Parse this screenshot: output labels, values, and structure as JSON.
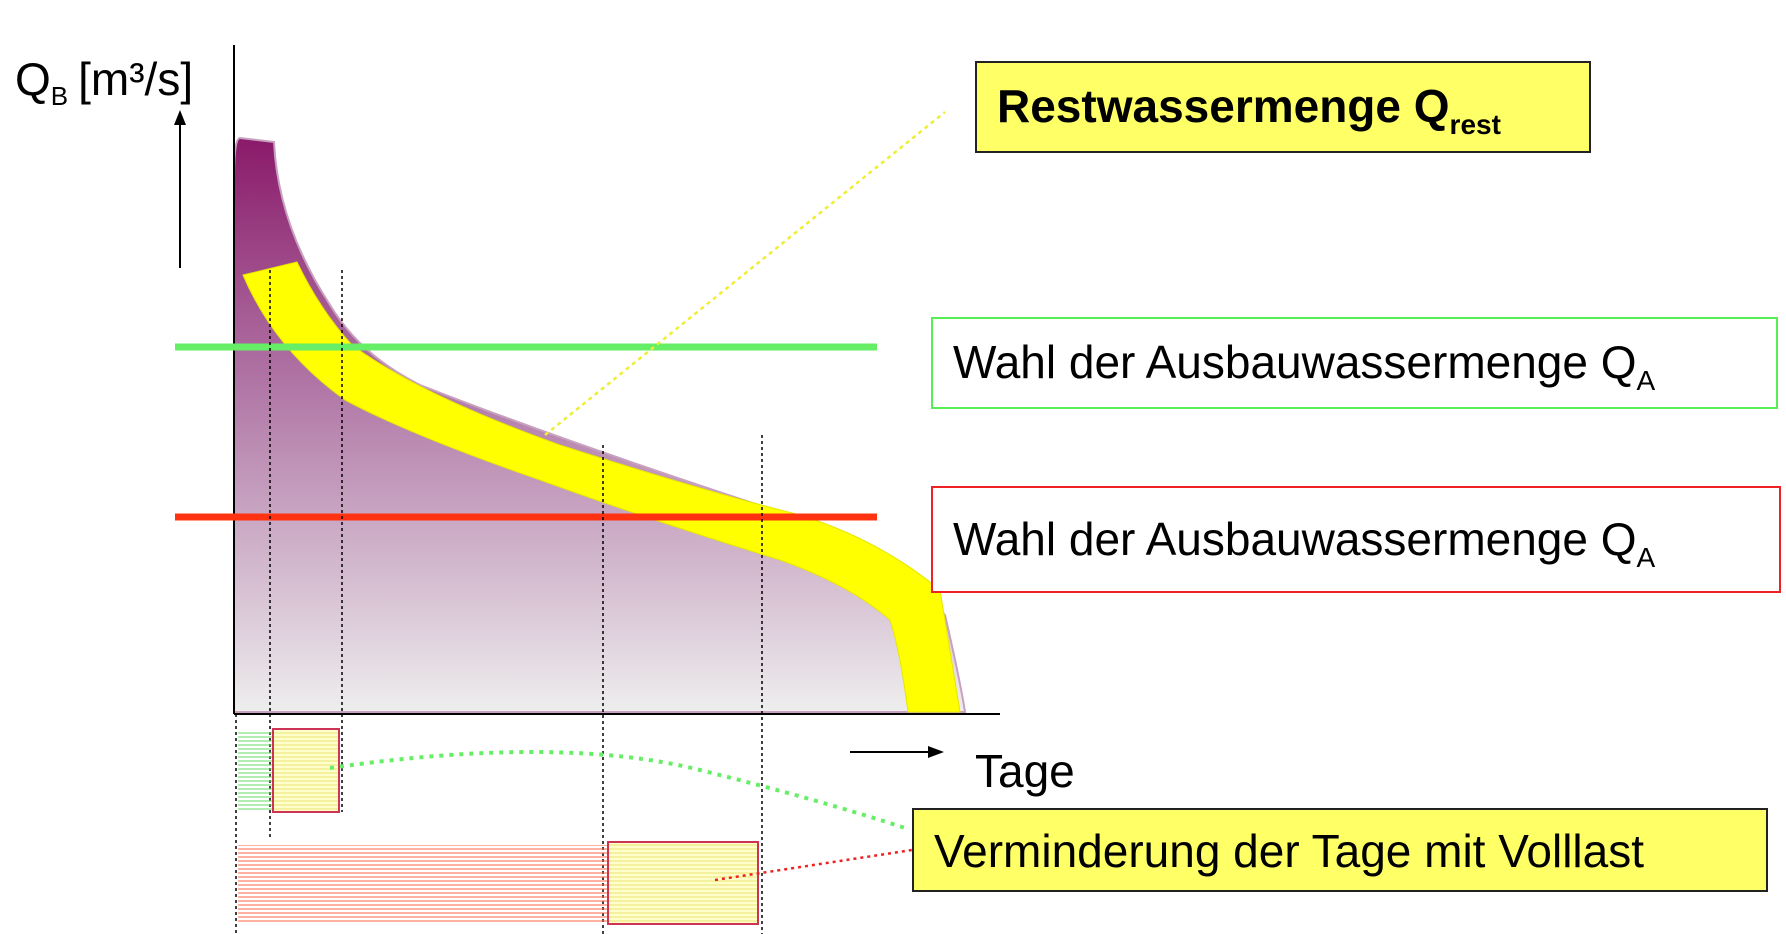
{
  "axes": {
    "y_label_main": "Q",
    "y_label_sub": "B",
    "y_label_unit": "[m³/s]",
    "x_label": "Tage"
  },
  "labels": {
    "rest_main": "Restwassermenge Q",
    "rest_sub": "rest",
    "qa_green_main": "Wahl der Ausbauwassermenge Q",
    "qa_green_sub": "A",
    "qa_red_main": "Wahl der Ausbauwassermenge Q",
    "qa_red_sub": "A",
    "days": "Verminderung der Tage mit Volllast"
  },
  "colors": {
    "curve_top": "#8a1a6a",
    "curve_bottom": "#ececec",
    "restwasser_band": "#ffff00",
    "green_line": "#66ee66",
    "red_line": "#ff3311",
    "box_fill": "#ffff66"
  }
}
